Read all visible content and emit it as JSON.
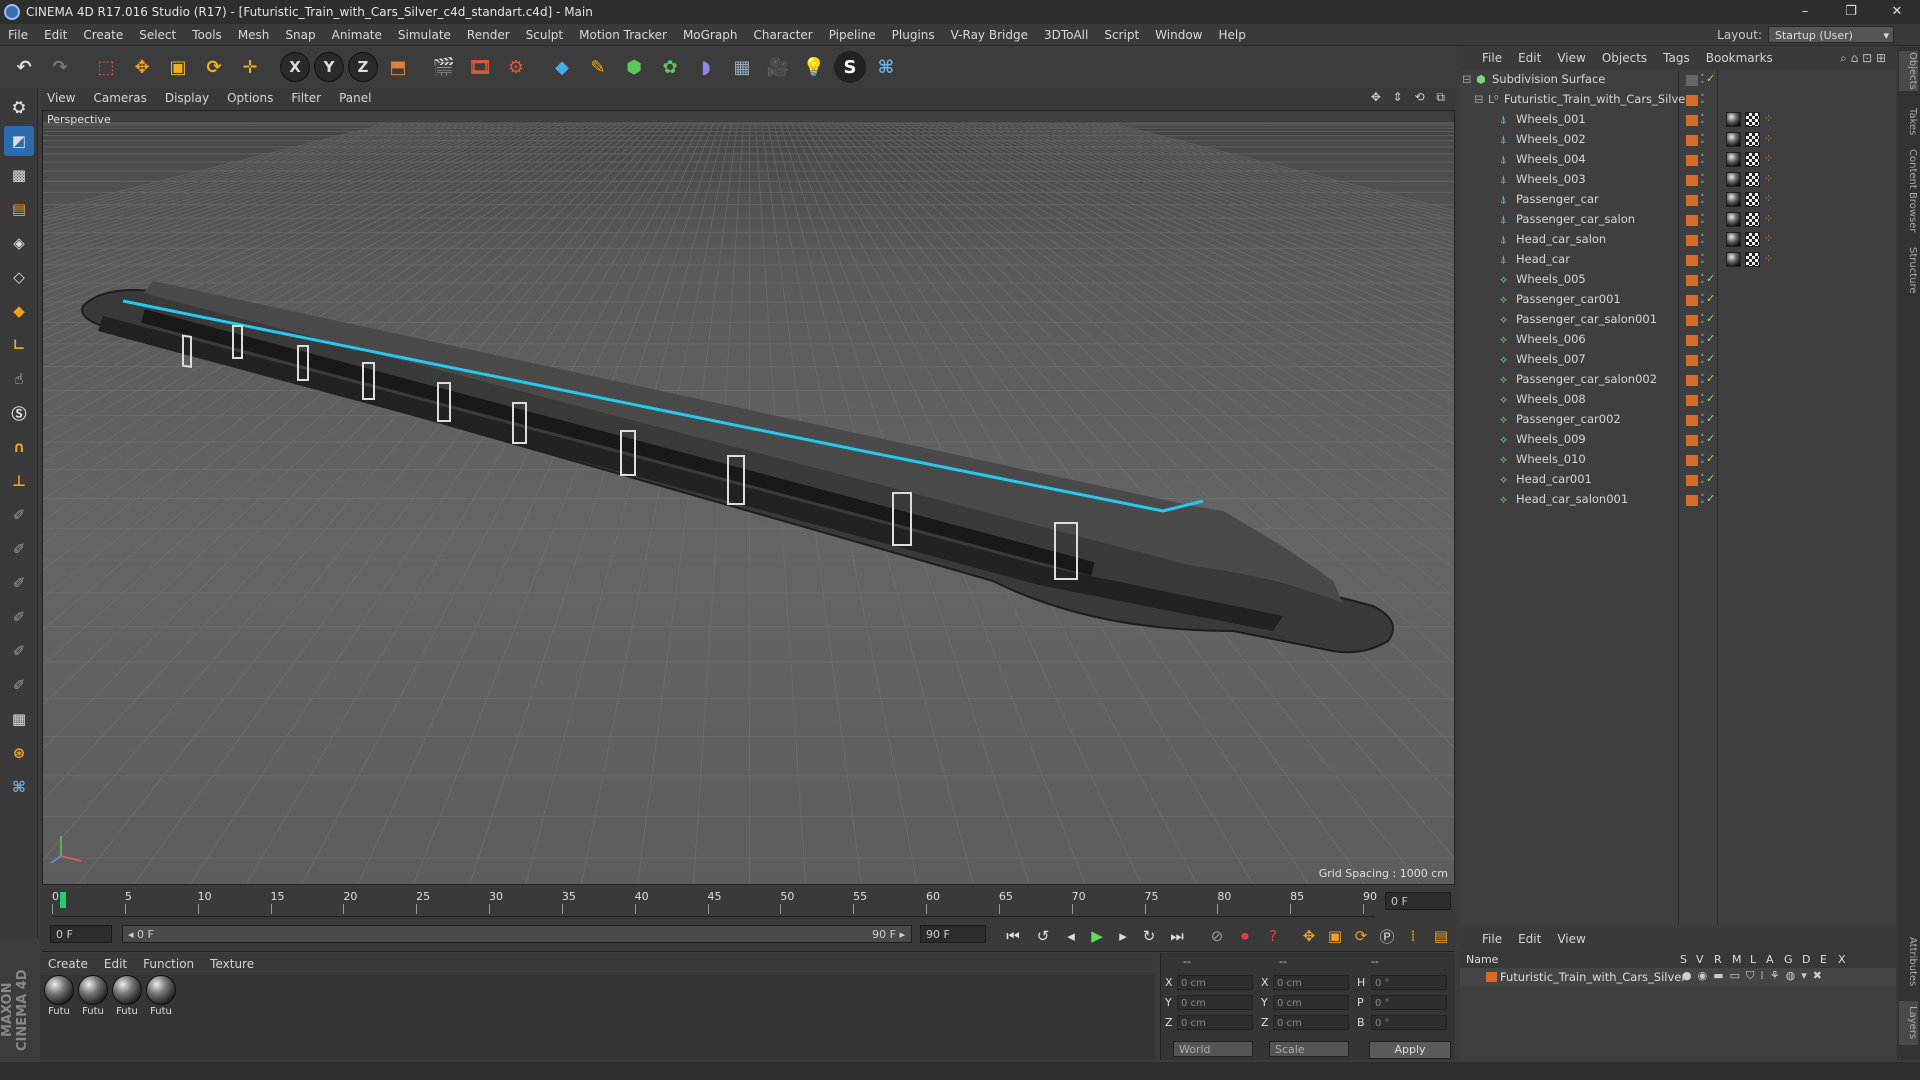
{
  "window": {
    "title": "CINEMA 4D R17.016 Studio (R17) - [Futuristic_Train_with_Cars_Silver_c4d_standart.c4d] - Main",
    "controls": [
      "–",
      "❐",
      "✕"
    ]
  },
  "menubar": {
    "items": [
      "File",
      "Edit",
      "Create",
      "Select",
      "Tools",
      "Mesh",
      "Snap",
      "Animate",
      "Simulate",
      "Render",
      "Sculpt",
      "Motion Tracker",
      "MoGraph",
      "Character",
      "Pipeline",
      "Plugins",
      "V-Ray Bridge",
      "3DToAll",
      "Script",
      "Window",
      "Help"
    ],
    "layout_label": "Layout:",
    "layout_value": "Startup (User)"
  },
  "toolbar": {
    "axis_x": "X",
    "axis_y": "Y",
    "axis_z": "Z"
  },
  "viewport": {
    "menu": [
      "View",
      "Cameras",
      "Display",
      "Options",
      "Filter",
      "Panel"
    ],
    "label": "Perspective",
    "grid_spacing": "Grid Spacing : 1000 cm",
    "nav_icons": "✥ ⇕ ⟲ ⧉"
  },
  "timeline": {
    "ticks": [
      "0",
      "5",
      "10",
      "15",
      "20",
      "25",
      "30",
      "35",
      "40",
      "45",
      "50",
      "55",
      "60",
      "65",
      "70",
      "75",
      "80",
      "85",
      "90"
    ],
    "frame_end_display": "0 F"
  },
  "transport": {
    "current_frame": "0 F",
    "range_start": "◂ 0 F",
    "range_end": "90 F ▸",
    "max_frame": "90 F"
  },
  "materials": {
    "menu": [
      "Create",
      "Edit",
      "Function",
      "Texture"
    ],
    "items": [
      "Futu",
      "Futu",
      "Futu",
      "Futu"
    ]
  },
  "coordinates": {
    "header": [
      "--",
      "--",
      "--"
    ],
    "rows": [
      {
        "a": "X",
        "av": "0 cm",
        "b": "X",
        "bv": "0 cm",
        "c": "H",
        "cv": "0 °"
      },
      {
        "a": "Y",
        "av": "0 cm",
        "b": "Y",
        "bv": "0 cm",
        "c": "P",
        "cv": "0 °"
      },
      {
        "a": "Z",
        "av": "0 cm",
        "b": "Z",
        "bv": "0 cm",
        "c": "B",
        "cv": "0 °"
      }
    ],
    "space": "World",
    "mode": "Scale",
    "apply": "Apply"
  },
  "objects": {
    "menu": [
      "File",
      "Edit",
      "View",
      "Objects",
      "Tags",
      "Bookmarks"
    ],
    "tree": [
      {
        "name": "Subdivision Surface",
        "level": 0,
        "kind": "gen",
        "tags": []
      },
      {
        "name": "Futuristic_Train_with_Cars_Silver",
        "level": 1,
        "kind": "null",
        "tags": []
      },
      {
        "name": "Wheels_001",
        "level": 2,
        "kind": "bone",
        "tags": [
          "sph",
          "chk",
          "dot"
        ]
      },
      {
        "name": "Wheels_002",
        "level": 2,
        "kind": "bone",
        "tags": [
          "sph",
          "chk",
          "dot"
        ]
      },
      {
        "name": "Wheels_004",
        "level": 2,
        "kind": "bone",
        "tags": [
          "sph",
          "chk",
          "dot"
        ]
      },
      {
        "name": "Wheels_003",
        "level": 2,
        "kind": "bone",
        "tags": [
          "sph",
          "chk",
          "dot"
        ]
      },
      {
        "name": "Passenger_car",
        "level": 2,
        "kind": "bone",
        "tags": [
          "sph",
          "chk",
          "dot"
        ]
      },
      {
        "name": "Passenger_car_salon",
        "level": 2,
        "kind": "bone",
        "tags": [
          "sph",
          "chk",
          "dot"
        ]
      },
      {
        "name": "Head_car_salon",
        "level": 2,
        "kind": "bone",
        "tags": [
          "sph",
          "chk",
          "dot"
        ]
      },
      {
        "name": "Head_car",
        "level": 2,
        "kind": "bone",
        "tags": [
          "sph",
          "chk",
          "dot"
        ]
      },
      {
        "name": "Wheels_005",
        "level": 2,
        "kind": "poly",
        "tags": []
      },
      {
        "name": "Passenger_car001",
        "level": 2,
        "kind": "poly",
        "tags": []
      },
      {
        "name": "Passenger_car_salon001",
        "level": 2,
        "kind": "poly",
        "tags": []
      },
      {
        "name": "Wheels_006",
        "level": 2,
        "kind": "poly",
        "tags": []
      },
      {
        "name": "Wheels_007",
        "level": 2,
        "kind": "poly",
        "tags": []
      },
      {
        "name": "Passenger_car_salon002",
        "level": 2,
        "kind": "poly",
        "tags": []
      },
      {
        "name": "Wheels_008",
        "level": 2,
        "kind": "poly",
        "tags": []
      },
      {
        "name": "Passenger_car002",
        "level": 2,
        "kind": "poly",
        "tags": []
      },
      {
        "name": "Wheels_009",
        "level": 2,
        "kind": "poly",
        "tags": []
      },
      {
        "name": "Wheels_010",
        "level": 2,
        "kind": "poly",
        "tags": []
      },
      {
        "name": "Head_car001",
        "level": 2,
        "kind": "poly",
        "tags": []
      },
      {
        "name": "Head_car_salon001",
        "level": 2,
        "kind": "poly",
        "tags": []
      }
    ]
  },
  "sidetabs": [
    "Objects",
    "Takes",
    "Content Browser",
    "Structure",
    "Attributes",
    "Layers"
  ],
  "layers": {
    "menu": [
      "File",
      "Edit",
      "View"
    ],
    "columns": [
      "Name",
      "S",
      "V",
      "R",
      "M",
      "L",
      "A",
      "G",
      "D",
      "E",
      "X"
    ],
    "row_name": "Futuristic_Train_with_Cars_Silver"
  },
  "brand": "MAXON CINEMA 4D",
  "colors": {
    "accent_cyan": "#27c8f0",
    "layer_orange": "#d86b28",
    "playhead_green": "#1fd16b"
  }
}
